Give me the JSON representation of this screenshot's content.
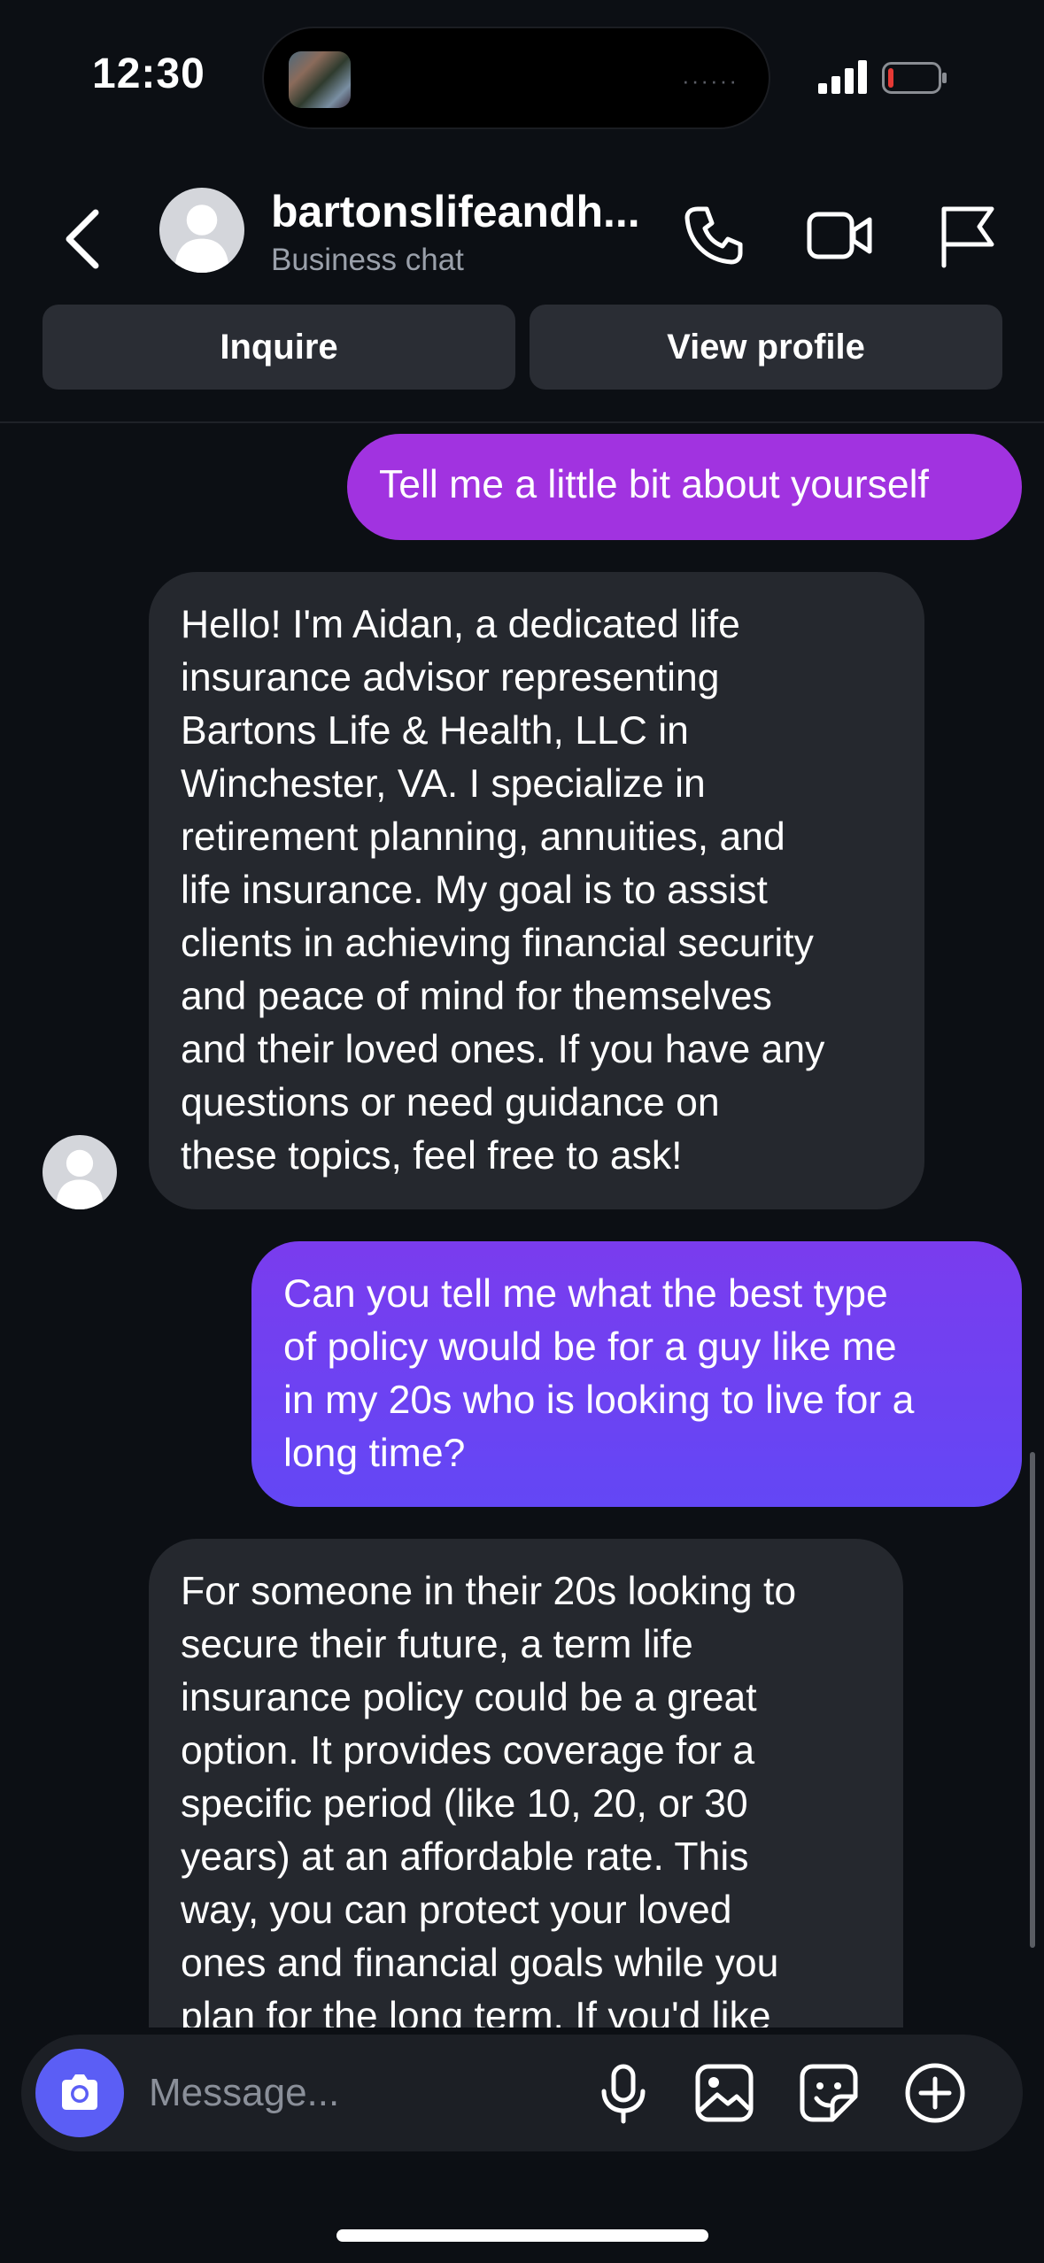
{
  "status_bar": {
    "time": "12:30"
  },
  "header": {
    "title": "bartonslifeandh...",
    "subtitle": "Business chat"
  },
  "actions": {
    "inquire": "Inquire",
    "view_profile": "View profile"
  },
  "messages": [
    {
      "sender": "user",
      "lines": [
        "Tell me a little bit about yourself"
      ]
    },
    {
      "sender": "business",
      "lines": [
        "Hello! I'm Aidan, a dedicated life",
        "insurance advisor representing",
        "Bartons Life & Health, LLC in",
        "Winchester, VA. I specialize in",
        "retirement planning, annuities, and",
        "life insurance. My goal is to assist",
        "clients in achieving financial security",
        "and peace of mind for themselves",
        "and their loved ones. If you have any",
        "questions or need guidance on",
        "these topics, feel free to ask!"
      ]
    },
    {
      "sender": "user",
      "lines": [
        "Can you tell me what the best type",
        "of policy would be for a guy like me",
        "in my 20s who is looking to live for a",
        "long time?"
      ]
    },
    {
      "sender": "business",
      "lines": [
        "For someone in their 20s looking to",
        "secure their future, a term life",
        "insurance policy could be a great",
        "option. It provides coverage for a",
        "specific period (like 10, 20, or 30",
        "years) at an affordable rate. This",
        "way, you can protect your loved",
        "ones and financial goals while you",
        "plan for the long term. If you'd like"
      ]
    }
  ],
  "composer": {
    "placeholder": "Message..."
  },
  "colors": {
    "background": "#0c0f14",
    "user_bubble_1": "#a133e0",
    "user_bubble_2": "#6e42f5",
    "business_bubble": "#25282e",
    "camera_button": "#5b5ef5",
    "battery_low": "#e53935"
  },
  "icons": [
    "back-icon",
    "phone-icon",
    "video-camera-icon",
    "flag-icon",
    "camera-icon",
    "microphone-icon",
    "gallery-icon",
    "sticker-icon",
    "plus-icon"
  ]
}
